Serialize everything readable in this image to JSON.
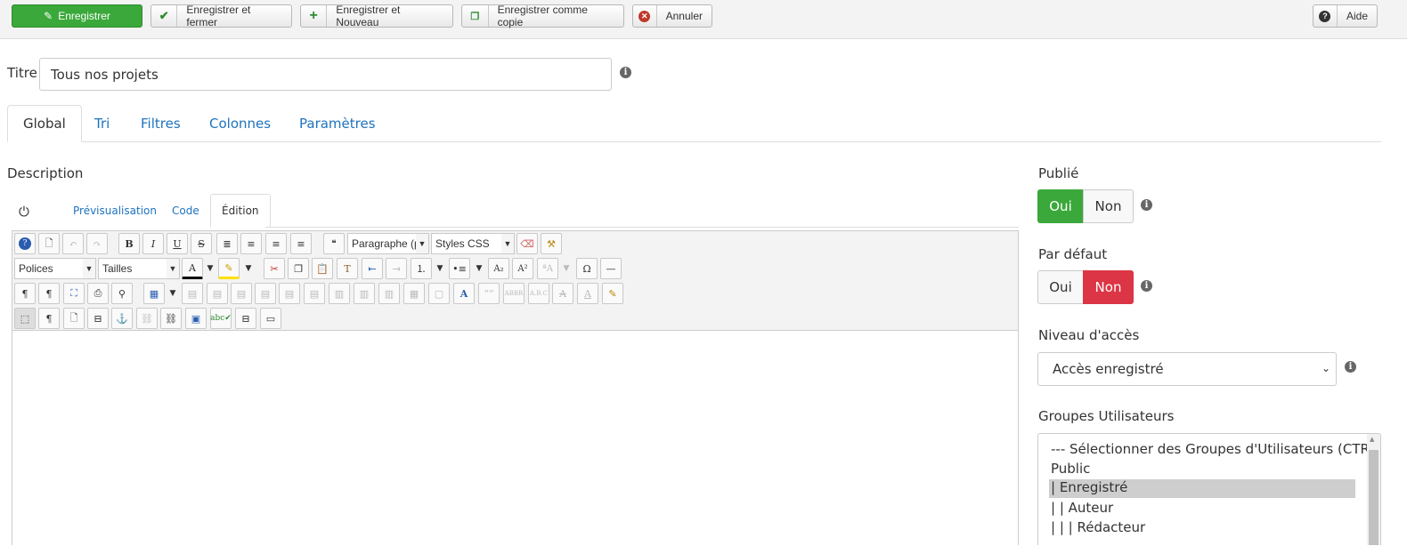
{
  "toolbar": {
    "save": "Enregistrer",
    "save_close": "Enregistrer et fermer",
    "save_new": "Enregistrer et Nouveau",
    "save_copy": "Enregistrer comme copie",
    "cancel": "Annuler",
    "help": "Aide"
  },
  "title": {
    "label": "Titre",
    "value": "Tous nos projets"
  },
  "tabs": [
    "Global",
    "Tri",
    "Filtres",
    "Colonnes",
    "Paramètres"
  ],
  "description": {
    "label": "Description",
    "tabs": [
      "Prévisualisation",
      "Code",
      "Édition"
    ]
  },
  "editor": {
    "format": "Paragraphe (p",
    "styles": "Styles CSS",
    "fonts": "Polices",
    "sizes": "Tailles"
  },
  "published": {
    "label": "Publié",
    "yes": "Oui",
    "no": "Non"
  },
  "default": {
    "label": "Par défaut",
    "yes": "Oui",
    "no": "Non"
  },
  "access": {
    "label": "Niveau d'accès",
    "value": "Accès enregistré"
  },
  "groups": {
    "label": "Groupes Utilisateurs",
    "items": [
      "--- Sélectionner des Groupes d'Utilisateurs (CTR/CMD",
      "Public",
      "| Enregistré",
      "| | Auteur",
      "| | | Rédacteur"
    ],
    "selected": "| Enregistré"
  },
  "colors": {
    "green": "#3aa83a",
    "red": "#dc3545",
    "link": "#1e73be"
  }
}
